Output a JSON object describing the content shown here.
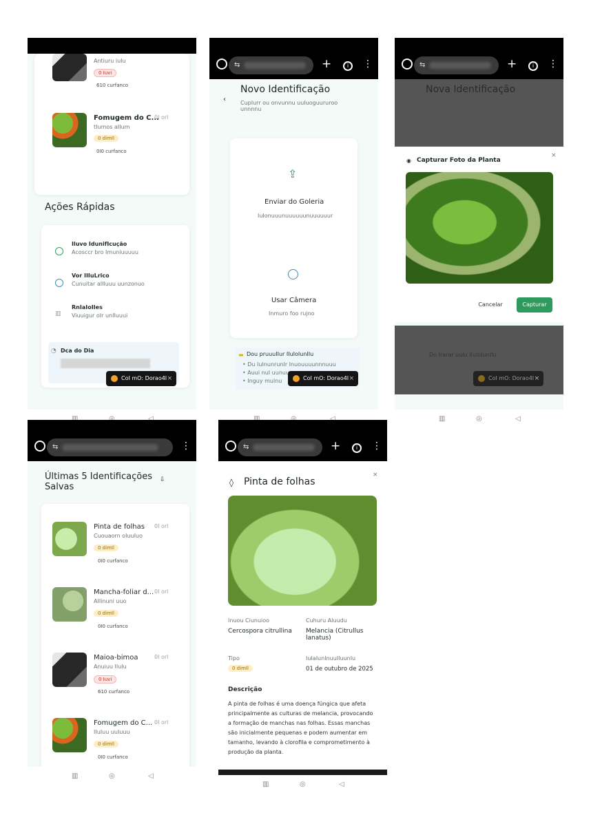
{
  "colors": {
    "accent": "#2e9a5c",
    "bg": "#f3faf8",
    "toast": "#151515",
    "badge_red": "#c8302c",
    "badge_yellow": "#9a6b07"
  },
  "s1": {
    "item1": {
      "title": "",
      "subtitle": "Antiuru iuIu",
      "badge": "0 Iuvi",
      "conf": "610 curfanco"
    },
    "item2": {
      "title": "Fomugem do C...",
      "subtitle": "tIumos aIIum",
      "badge": "0 dimIl",
      "conf": "0I0 curfanco",
      "date": "0I orl"
    },
    "quick_title": "Ações Rápidas",
    "actions": [
      {
        "title": "Iluvo IdunifIcução",
        "sub": "Acosccr bro Imuniuuuuu"
      },
      {
        "title": "Vor IIIuLrico",
        "sub": "Cunuitar aIIluuu uunzonuo"
      },
      {
        "title": "RnIaIoIIes",
        "sub": "Viuuigur oIr unIIuuui"
      }
    ],
    "tip_title": "Dca do Dia",
    "tip_text": "I",
    "toast": "CoI mO: Dorao4I"
  },
  "s2": {
    "title": "Novo Identificação",
    "subtitle": "CupIurr ou onvunnu uuIuoguururoo unnnnu",
    "upload_title": "Enviar do Goleria",
    "upload_sub": "IuIonuuunuuuuuunuuuuuur",
    "camera_title": "Usar Câmera",
    "camera_sub": "Inmuro foo rujno",
    "tips_title": "Dou pruuuIIur IIuIoIunIIu",
    "tips": [
      "• Du IuInunrunIr Inuouuuunnnuuu",
      "• Auui nuI uunuu",
      "• Inguy mulnu"
    ],
    "toast": "CoI mO: Dorao4I"
  },
  "s3": {
    "bg_title": "Nova Identificação",
    "dialog_title": "Capturar Foto da Planta",
    "cancel": "Cancelar",
    "capture": "Capturar",
    "bg_tip": "Do Irarar uuIu IIuIoIunIIu",
    "toast": "CoI mO: Dorao4I"
  },
  "s4": {
    "title": "Últimas 5 Identificações Salvas",
    "items": [
      {
        "title": "Pinta de folhas",
        "subtitle": "Cuouaorn oIuuIuo",
        "badge": "0 dimIl",
        "conf": "0I0 curfanco",
        "date": "0I orl"
      },
      {
        "title": "Mancha-foliar d...",
        "subtitle": "AIIinuni uuo",
        "badge": "0 dimIl",
        "conf": "0I0 curfanco",
        "date": "0I orl"
      },
      {
        "title": "Maioa-bimoa",
        "subtitle": "Anuiuu IIuIu",
        "badge": "0 Iuvi",
        "conf": "610 curfanco",
        "date": "0I orl"
      },
      {
        "title": "Fomugem do C...",
        "subtitle": "IIuIuu uuIuuu",
        "badge": "0 dimIl",
        "conf": "0I0 curfanco",
        "date": "0I orl"
      }
    ]
  },
  "s5": {
    "title": "Pinta de folhas",
    "field1_label": "Inuou Ciunuioo",
    "field1_value": "Cercospora citrullina",
    "field2_label": "Cuhuru AIuudu",
    "field2_value": "Melancia (Citrullus lanatus)",
    "type_label": "Tipo",
    "type_value": "0 dimIl",
    "date_label": "IuIaIunInuuIIuunIu",
    "date_value": "01 de outubro de 2025",
    "desc_label": "Descrição",
    "desc_text": "A pinta de folhas é uma doença fúngica que afeta principalmente as culturas de melancia, provocando a formação de manchas nas folhas. Essas manchas são inicialmente pequenas e podem aumentar em tamanho, levando à clorofila e comprometimento à produção da planta."
  }
}
